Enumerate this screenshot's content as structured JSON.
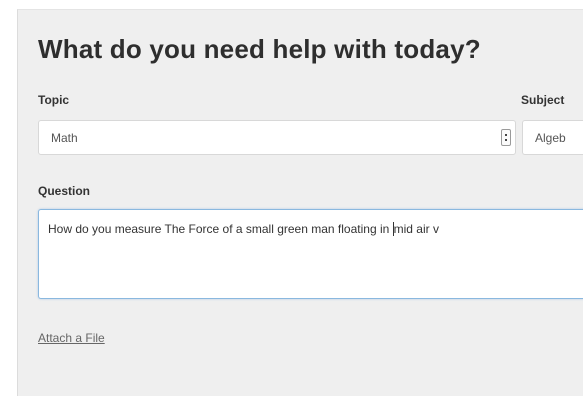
{
  "form": {
    "title": "What do you need help with today?",
    "topic": {
      "label": "Topic",
      "value": "Math"
    },
    "subject": {
      "label": "Subject",
      "value": "Algeb"
    },
    "question": {
      "label": "Question",
      "text_before_caret": "How do you measure The Force of a small green man floating in ",
      "text_after_caret": "mid air v"
    },
    "attach_label": "Attach a File"
  },
  "colors": {
    "panel_background": "#efefef",
    "textarea_focus_border": "#8ab8df"
  }
}
